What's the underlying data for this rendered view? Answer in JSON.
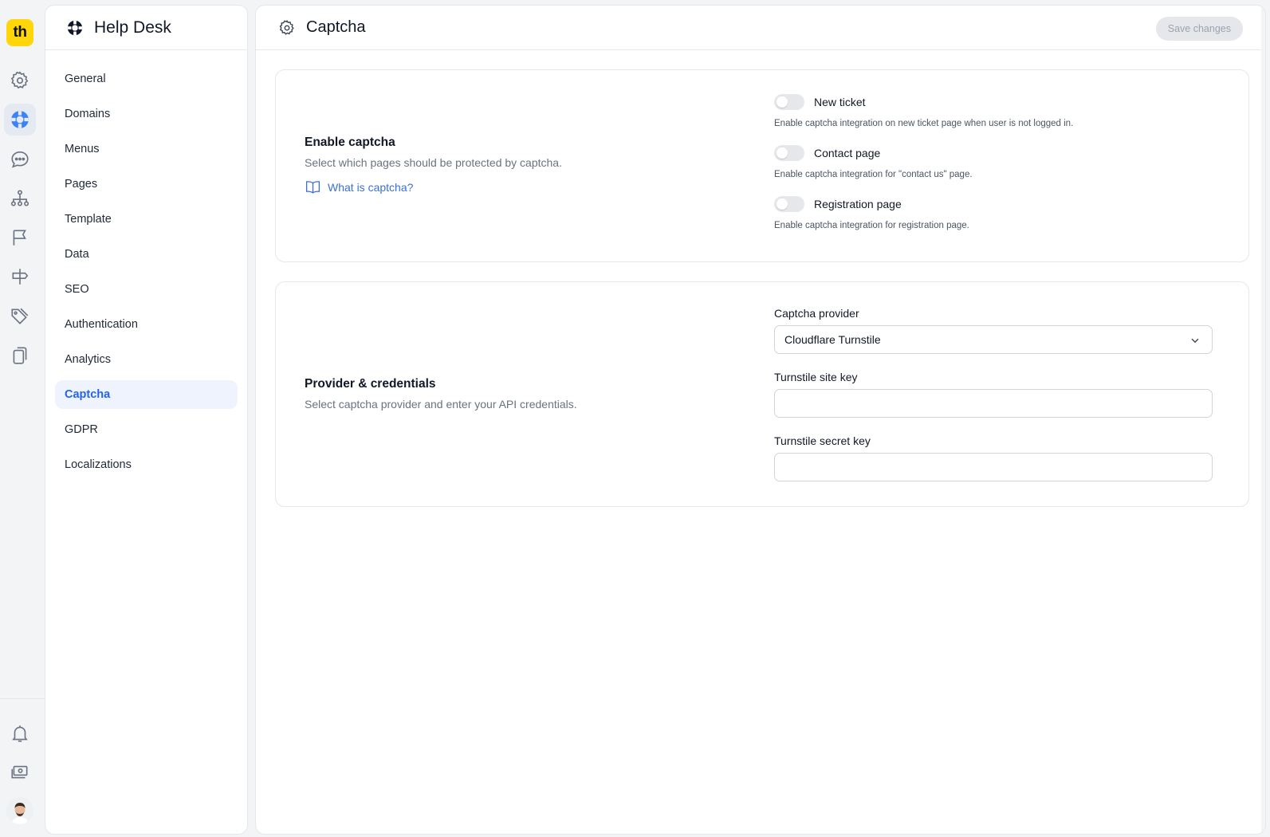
{
  "rail": {
    "logo_text": "th",
    "items": [
      {
        "name": "settings",
        "icon": "gear-icon"
      },
      {
        "name": "help-desk",
        "icon": "lifebuoy-icon",
        "active": true
      },
      {
        "name": "chat",
        "icon": "chat-bubble-icon"
      },
      {
        "name": "org",
        "icon": "hierarchy-icon"
      },
      {
        "name": "flag",
        "icon": "flag-icon"
      },
      {
        "name": "signpost",
        "icon": "signpost-icon"
      },
      {
        "name": "tags",
        "icon": "tags-icon"
      },
      {
        "name": "copy",
        "icon": "copy-icon"
      }
    ],
    "bottom": [
      {
        "name": "notifications",
        "icon": "bell-icon"
      },
      {
        "name": "billing",
        "icon": "money-icon"
      }
    ]
  },
  "nav": {
    "title": "Help Desk",
    "items": [
      {
        "label": "General"
      },
      {
        "label": "Domains"
      },
      {
        "label": "Menus"
      },
      {
        "label": "Pages"
      },
      {
        "label": "Template"
      },
      {
        "label": "Data"
      },
      {
        "label": "SEO"
      },
      {
        "label": "Authentication"
      },
      {
        "label": "Analytics"
      },
      {
        "label": "Captcha",
        "active": true
      },
      {
        "label": "GDPR"
      },
      {
        "label": "Localizations"
      }
    ]
  },
  "header": {
    "title": "Captcha",
    "save_label": "Save changes"
  },
  "enable_section": {
    "title": "Enable captcha",
    "description": "Select which pages should be protected by captcha.",
    "link": "What is captcha?",
    "toggles": [
      {
        "label": "New ticket",
        "hint": "Enable captcha integration on new ticket page when user is not logged in.",
        "on": false
      },
      {
        "label": "Contact page",
        "hint": "Enable captcha integration for \"contact us\" page.",
        "on": false
      },
      {
        "label": "Registration page",
        "hint": "Enable captcha integration for registration page.",
        "on": false
      }
    ]
  },
  "provider_section": {
    "title": "Provider & credentials",
    "description": "Select captcha provider and enter your API credentials.",
    "provider_label": "Captcha provider",
    "provider_value": "Cloudflare Turnstile",
    "site_key_label": "Turnstile site key",
    "site_key_value": "",
    "secret_key_label": "Turnstile secret key",
    "secret_key_value": ""
  },
  "colors": {
    "accent": "#2563eb",
    "logo": "#ffd60a",
    "active_nav_bg": "#eef3fd"
  }
}
